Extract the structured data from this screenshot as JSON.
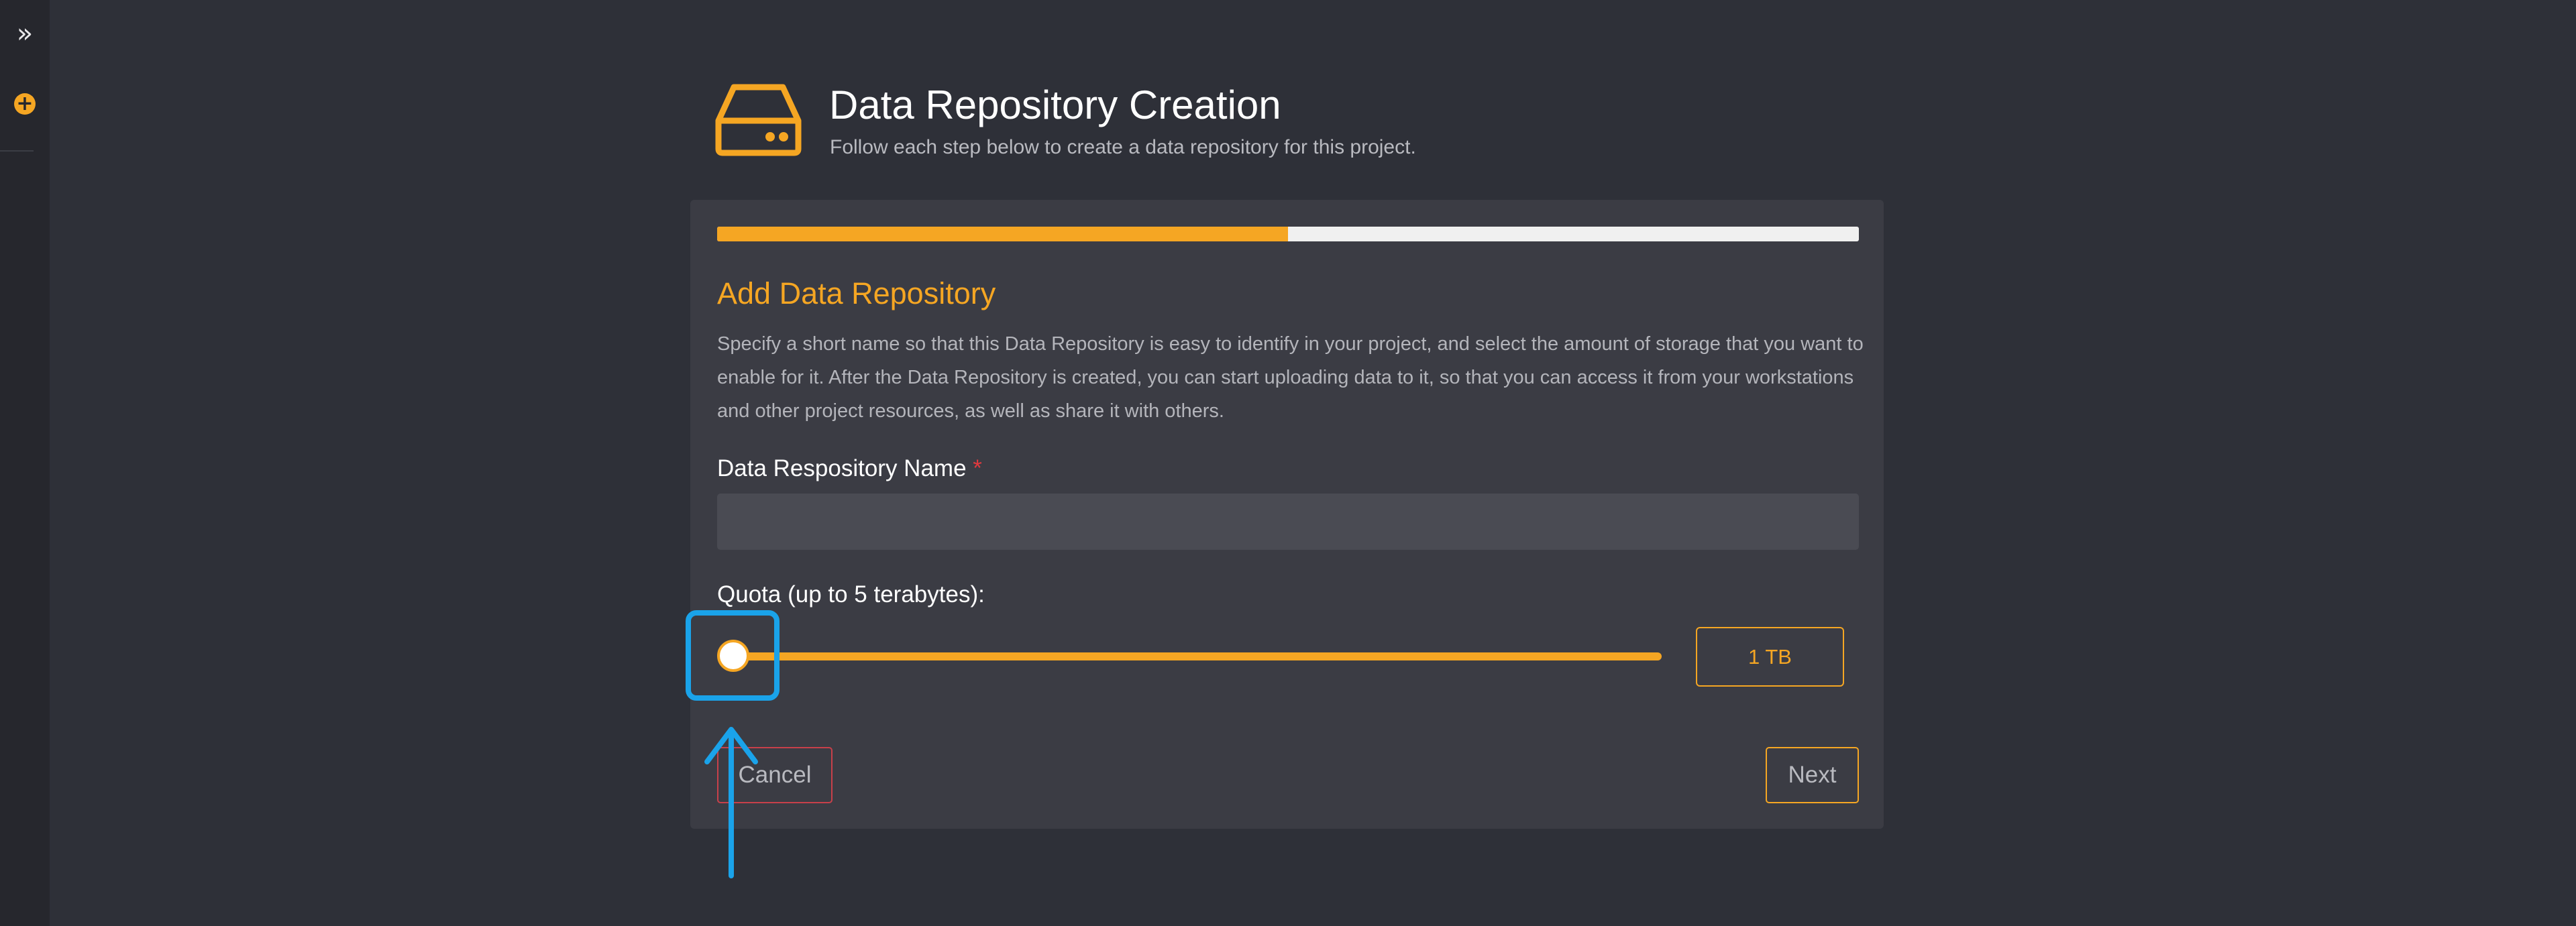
{
  "sidebar": {
    "expand_icon": "double-chevron-right-icon",
    "add_icon": "plus-circle-icon"
  },
  "header": {
    "icon": "hard-drive-icon",
    "title": "Data Repository Creation",
    "subtitle": "Follow each step below to create a data repository for this project."
  },
  "wizard": {
    "progress_percent": 50,
    "step_title": "Add Data Repository",
    "description": "Specify a short name so that this Data Repository is easy to identify in your project, and select the amount of storage that you want to enable for it. After the Data Repository is created, you can start uploading data to it, so that you can access it from your workstations and other project resources, as well as share it with others."
  },
  "form": {
    "name_label": "Data Respository Name",
    "required_marker": "*",
    "name_value": "",
    "quota_label": "Quota (up to 5 terabytes):",
    "quota_slider_value_tb": 1,
    "quota_slider_min_tb": 1,
    "quota_slider_max_tb": 5,
    "quota_display": "1 TB"
  },
  "actions": {
    "cancel_label": "Cancel",
    "next_label": "Next"
  },
  "colors": {
    "accent": "#f5a623",
    "background": "#2e3038",
    "card": "#3b3c44",
    "annotation": "#1aa3ea",
    "danger": "#c8404a"
  }
}
